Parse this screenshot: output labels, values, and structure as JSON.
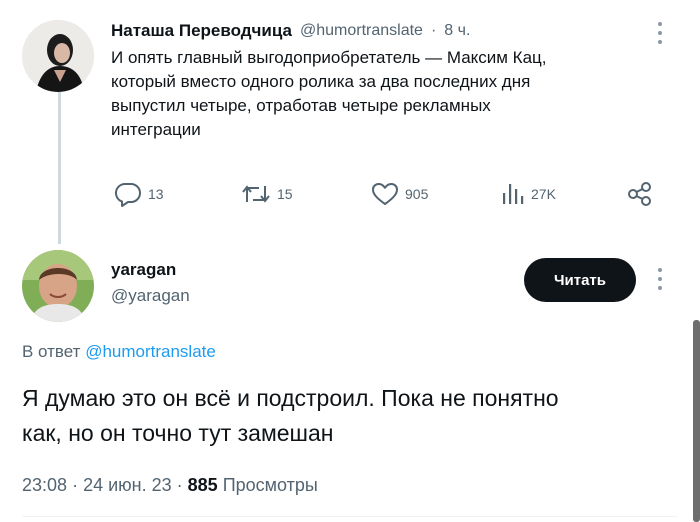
{
  "tweet1": {
    "display_name": "Наташа Переводчица",
    "handle": "@humortranslate",
    "separator": "·",
    "time": "8 ч.",
    "text_lines": [
      "И опять главный выгодоприобретатель — Максим Кац,",
      "который вместо одного ролика за два последних дня",
      "выпустил четыре, отработав четыре рекламных",
      "интеграции"
    ],
    "actions": {
      "replies": "13",
      "retweets": "15",
      "likes": "905",
      "views": "27K"
    }
  },
  "tweet2": {
    "display_name": "yaragan",
    "handle": "@yaragan",
    "follow_label": "Читать",
    "reply_prefix": "В ответ",
    "reply_to": "@humortranslate",
    "text_lines": [
      "Я думаю это он всё и подстроил. Пока не понятно",
      "как, но он точно тут замешан"
    ],
    "time": "23:08",
    "date": "24 июн. 23",
    "views_count": "885",
    "views_label": "Просмотры"
  },
  "icons": {
    "more": "more-icon",
    "reply": "reply-icon",
    "retweet": "retweet-icon",
    "like": "heart-icon",
    "views": "views-icon",
    "share": "share-icon"
  }
}
